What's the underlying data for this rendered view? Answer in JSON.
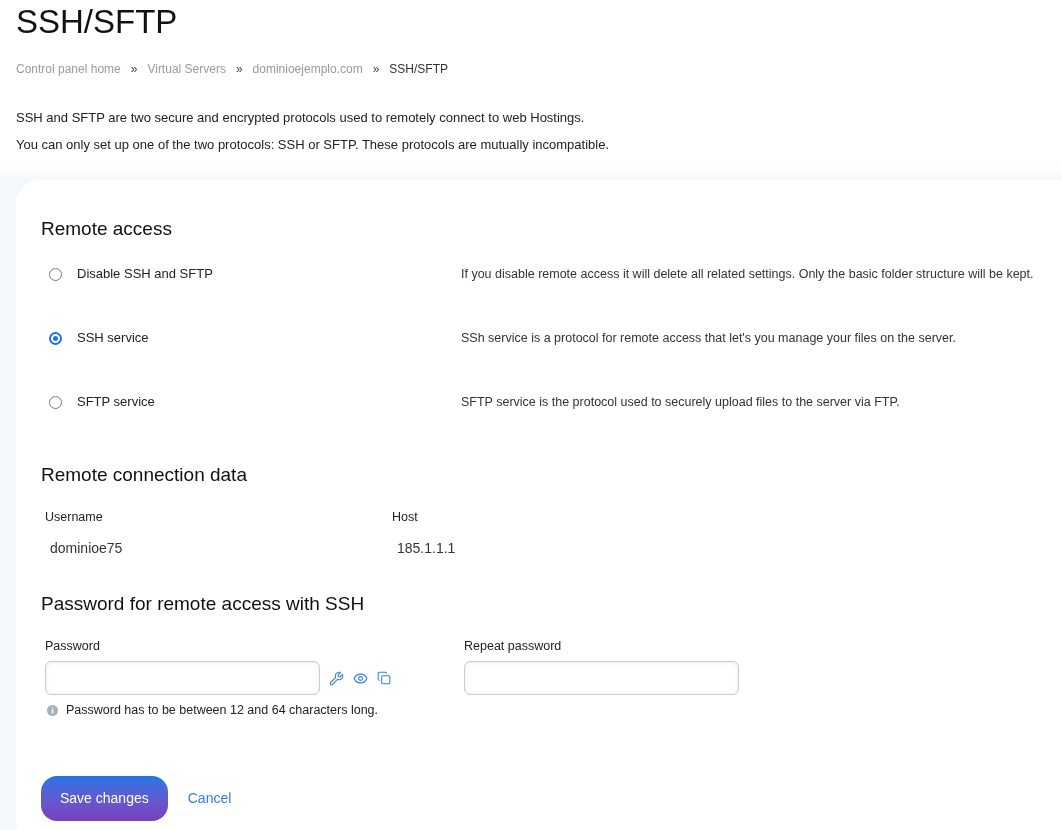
{
  "page": {
    "title": "SSH/SFTP"
  },
  "breadcrumb": {
    "items": [
      {
        "label": "Control panel home",
        "current": false
      },
      {
        "label": "Virtual Servers",
        "current": false
      },
      {
        "label": "dominioejemplo.com",
        "current": false
      },
      {
        "label": "SSH/SFTP",
        "current": true
      }
    ],
    "separators": [
      "»",
      "»",
      "»"
    ]
  },
  "intro": [
    "SSH and SFTP are two secure and encrypted protocols used to remotely connect to web Hostings.",
    "You can only set up one of the two protocols: SSH or SFTP. These protocols are mutually incompatible."
  ],
  "remote_access": {
    "heading": "Remote access",
    "options": [
      {
        "label": "Disable SSH and SFTP",
        "description": "If you disable remote access it will delete all related settings. Only the basic folder structure will be kept.",
        "selected": false
      },
      {
        "label": "SSH service",
        "description": "SSh service is a protocol for remote access that let's you manage your files on the server.",
        "selected": true
      },
      {
        "label": "SFTP service",
        "description": "SFTP service is the protocol used to securely upload files to the server via FTP.",
        "selected": false
      }
    ]
  },
  "connection": {
    "heading": "Remote connection data",
    "fields": [
      {
        "label": "Username",
        "value": "dominioe75"
      },
      {
        "label": "Host",
        "value": "185.1.1.1"
      }
    ]
  },
  "password": {
    "heading": "Password for remote access with SSH",
    "fields": [
      {
        "kind": "tools",
        "label": "Password",
        "hint": "Password has to be between 12 and 64 characters long."
      },
      {
        "kind": "plain",
        "label": "Repeat password"
      }
    ]
  },
  "actions": [
    {
      "kind": "primary",
      "label": "Save changes"
    },
    {
      "kind": "link",
      "label": "Cancel"
    }
  ]
}
